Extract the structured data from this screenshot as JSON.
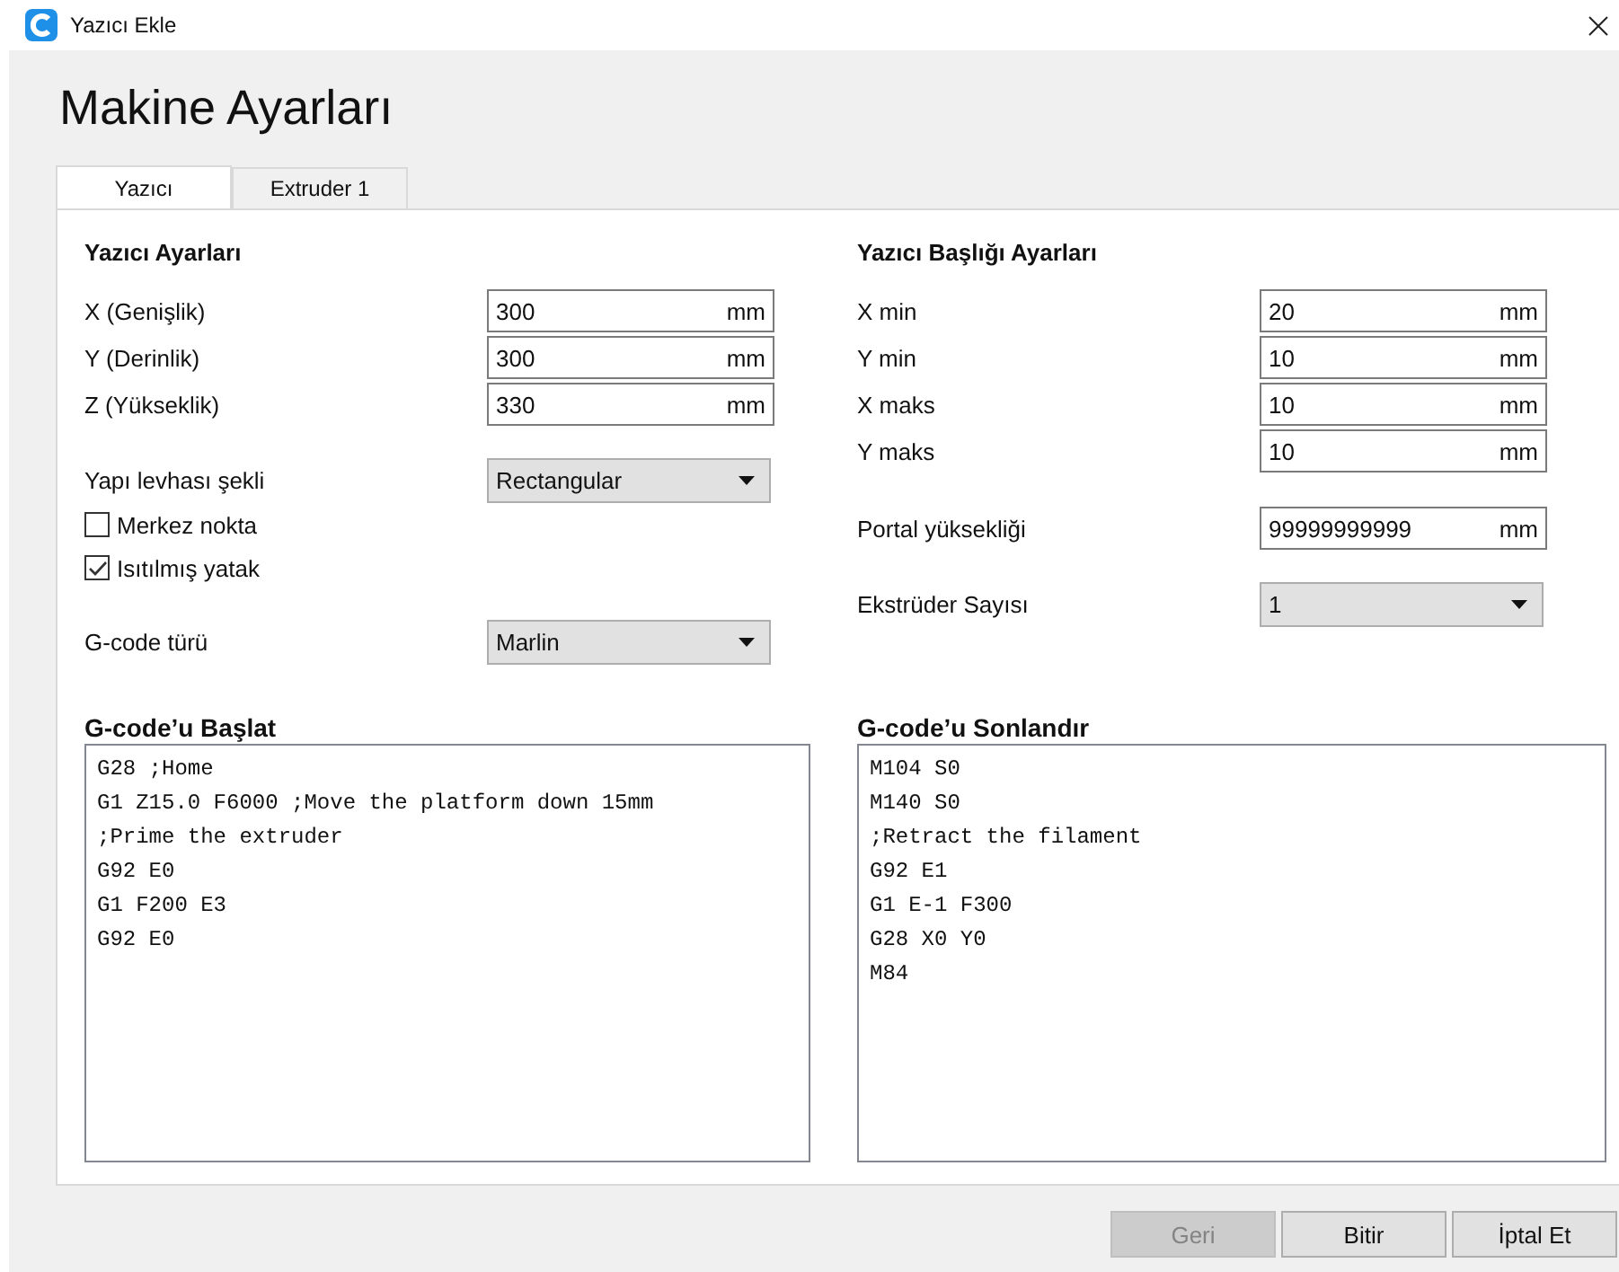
{
  "window": {
    "title": "Yazıcı Ekle"
  },
  "heading": "Makine Ayarları",
  "tabs": [
    {
      "label": "Yazıcı",
      "selected": true
    },
    {
      "label": "Extruder 1",
      "selected": false
    }
  ],
  "printer_settings": {
    "title": "Yazıcı Ayarları",
    "groups": [
      [
        {
          "kind": "number",
          "label": "X (Genişlik)",
          "value": "300",
          "unit": "mm"
        },
        {
          "kind": "number",
          "label": "Y (Derinlik)",
          "value": "300",
          "unit": "mm"
        },
        {
          "kind": "number",
          "label": "Z (Yükseklik)",
          "value": "330",
          "unit": "mm"
        }
      ],
      [
        {
          "kind": "combo",
          "label": "Yapı levhası şekli",
          "value": "Rectangular"
        },
        {
          "kind": "checkbox",
          "label": "Merkez nokta",
          "checked": false
        },
        {
          "kind": "checkbox",
          "label": "Isıtılmış yatak",
          "checked": true
        }
      ],
      [
        {
          "kind": "combo",
          "label": "G-code türü",
          "value": "Marlin"
        }
      ]
    ]
  },
  "head_settings": {
    "title": "Yazıcı Başlığı Ayarları",
    "groups": [
      [
        {
          "kind": "number",
          "label": "X min",
          "value": "20",
          "unit": "mm"
        },
        {
          "kind": "number",
          "label": "Y min",
          "value": "10",
          "unit": "mm"
        },
        {
          "kind": "number",
          "label": "X maks",
          "value": "10",
          "unit": "mm"
        },
        {
          "kind": "number",
          "label": "Y maks",
          "value": "10",
          "unit": "mm"
        }
      ],
      [
        {
          "kind": "number",
          "label": "Portal yüksekliği",
          "value": "99999999999",
          "unit": "mm"
        }
      ],
      [
        {
          "kind": "combo",
          "label": "Ekstrüder Sayısı",
          "value": "1"
        }
      ]
    ]
  },
  "start_gcode": {
    "title": "G-code’u Başlat",
    "lines": [
      "G28 ;Home",
      "G1 Z15.0 F6000 ;Move the platform down 15mm",
      ";Prime the extruder",
      "G92 E0",
      "G1 F200 E3",
      "G92 E0"
    ]
  },
  "end_gcode": {
    "title": "G-code’u Sonlandır",
    "lines": [
      "M104 S0",
      "M140 S0",
      ";Retract the filament",
      "G92 E1",
      "G1 E-1 F300",
      "G28 X0 Y0",
      "M84"
    ]
  },
  "buttons": [
    {
      "label": "Geri",
      "disabled": true
    },
    {
      "label": "Bitir",
      "disabled": false
    },
    {
      "label": "İptal Et",
      "disabled": false
    }
  ]
}
